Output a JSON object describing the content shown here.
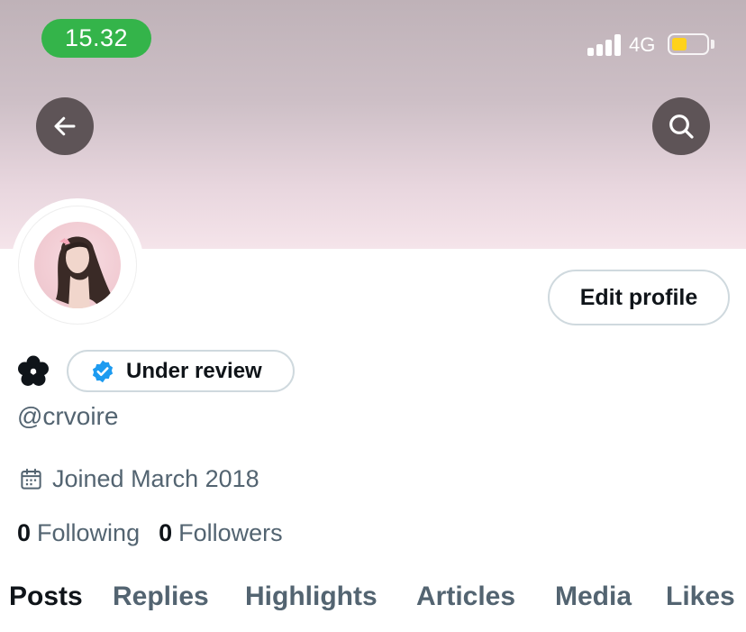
{
  "status_bar": {
    "time": "15.32",
    "network": "4G",
    "battery_level": 0.45,
    "time_pill_color": "#34b44a",
    "battery_color": "#ffd21a"
  },
  "header": {
    "back_icon": "arrow-left-icon",
    "search_icon": "search-icon"
  },
  "profile": {
    "edit_button_label": "Edit profile",
    "name_icon": "flower-icon",
    "verification_badge_label": "Under review",
    "verification_icon": "verified-badge-icon",
    "verification_color": "#1d9bf0",
    "handle": "@crvoire",
    "joined": "Joined March 2018",
    "following_count": "0",
    "following_label": "Following",
    "followers_count": "0",
    "followers_label": "Followers"
  },
  "tabs": [
    {
      "label": "Posts",
      "active": true
    },
    {
      "label": "Replies",
      "active": false
    },
    {
      "label": "Highlights",
      "active": false
    },
    {
      "label": "Articles",
      "active": false
    },
    {
      "label": "Media",
      "active": false
    },
    {
      "label": "Likes",
      "active": false
    }
  ]
}
